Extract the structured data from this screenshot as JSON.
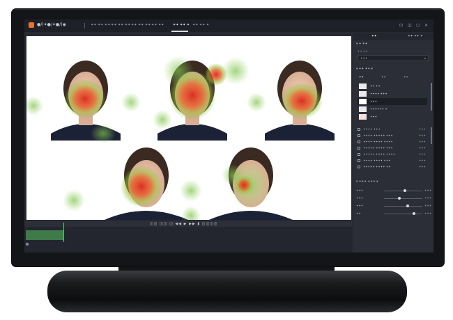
{
  "app": {
    "name": "●/(✦●/✦●/)◉",
    "menu": [
      "✦✦ ✦✦ ✦✦",
      "✦✦ ✦✦ ✦✦",
      "✦✦ ✦✦ ✦✦",
      "✦✦ ✦✦",
      "✦✦ ✦✦ ✦",
      "✦✦ ✦✦ ✦"
    ],
    "active_menu_index": 4,
    "window_controls": [
      "⊡",
      "◫",
      "▢",
      "✕"
    ]
  },
  "panel": {
    "tabs": [
      "✦✦",
      "✦✦ ✦✦ ✦"
    ],
    "section1": {
      "title": "▾ ✦ ✦✦",
      "label": "✦✦ ✦✦",
      "select_value": "✦✦✦",
      "select_arrow": "▾"
    },
    "section2": {
      "title": "▾ ✦✦ ✦✦ ▾",
      "subtabs": [
        "✦✦",
        "✦✦",
        "✦✦"
      ]
    },
    "thumbs": [
      {
        "label": "✦✦ ✦✦"
      },
      {
        "label": "✦✦✦✦ ✦✦✦"
      },
      {
        "label": "✦✦✦"
      },
      {
        "label": "✦✦✦✦✦✦ ✦"
      },
      {
        "label": "✦✦✦"
      }
    ],
    "checks": [
      {
        "label": "✦✦✦✦ ✦✦✦",
        "value": "✦✦✦"
      },
      {
        "label": "✦✦✦✦ ✦✦✦✦✦ ✦✦✦",
        "value": "✦✦✦"
      },
      {
        "label": "✦✦✦✦ ✦✦✦✦ ✦✦✦✦",
        "value": "✦✦✦"
      },
      {
        "label": "✦✦✦✦✦ ✦✦✦✦ ✦✦✦",
        "value": "✦✦✦"
      },
      {
        "label": "✦✦✦✦✦ ✦✦✦✦ ✦✦✦✦",
        "value": "✦✦✦"
      },
      {
        "label": "✦✦✦✦ ✦✦✦✦ ✦✦✦",
        "value": "✦✦✦"
      },
      {
        "label": "✦✦✦✦✦ ✦✦✦✦ ✦✦",
        "value": "✦✦✦"
      }
    ],
    "section3": {
      "title": "▾ ✦✦✦ ✦✦✦ ▾"
    },
    "sliders": [
      {
        "label": "✦✦✦",
        "value": "✦✦✦",
        "level": 0.55
      },
      {
        "label": "✦✦✦",
        "value": "✦✦✦",
        "level": 0.4
      },
      {
        "label": "✦✦✦",
        "value": "✦✦✦",
        "level": 0.62
      },
      {
        "label": "✦✦",
        "value": "✦✦✦",
        "level": 0.78
      }
    ]
  },
  "timeline": {
    "controls": "◫◫ ◫◫ ◫ ◀◀ ▶ ▶▶ ▮ ◫◫◫◫",
    "playhead_level": 0.12
  },
  "colors": {
    "heat_red": "#e53a2a",
    "heat_green": "#6fbf3a",
    "accent": "#e8732c"
  }
}
